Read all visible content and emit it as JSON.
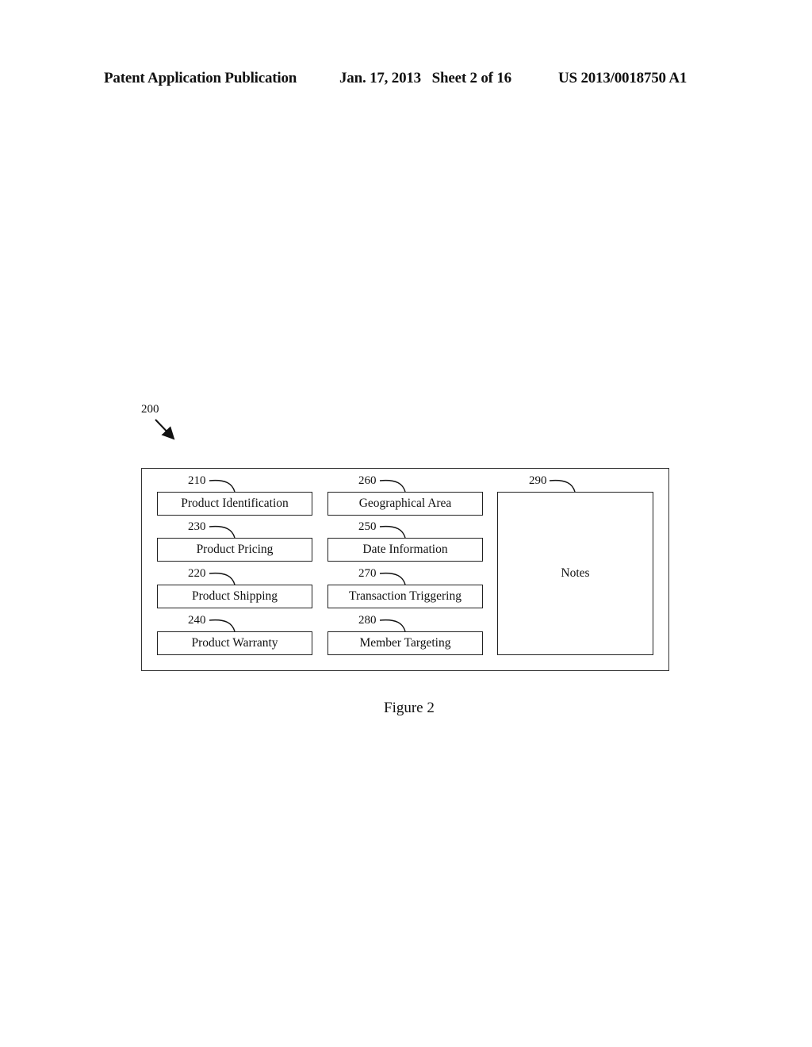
{
  "header": {
    "publication": "Patent Application Publication",
    "date_sheet": "Jan. 17, 2013   Sheet 2 of 16",
    "patent_number": "US 2013/0018750 A1"
  },
  "figure": {
    "ref": "200",
    "caption": "Figure 2",
    "fields": [
      {
        "ref": "210",
        "label": "Product Identification"
      },
      {
        "ref": "230",
        "label": "Product Pricing"
      },
      {
        "ref": "220",
        "label": "Product Shipping"
      },
      {
        "ref": "240",
        "label": "Product Warranty"
      },
      {
        "ref": "260",
        "label": "Geographical Area"
      },
      {
        "ref": "250",
        "label": "Date Information"
      },
      {
        "ref": "270",
        "label": "Transaction Triggering"
      },
      {
        "ref": "280",
        "label": "Member Targeting"
      }
    ],
    "notes": {
      "ref": "290",
      "label": "Notes"
    }
  }
}
